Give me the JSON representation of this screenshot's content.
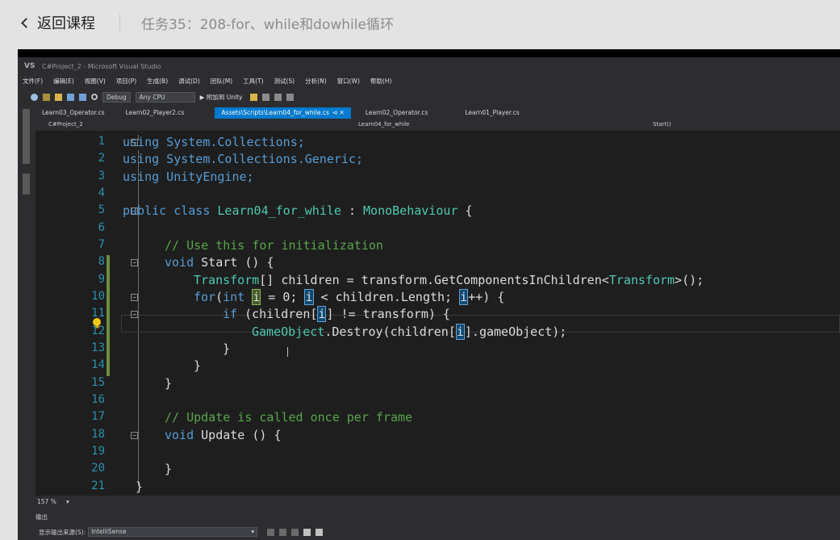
{
  "course": {
    "back_label": "返回课程",
    "task_title": "任务35：208-for、while和dowhile循环"
  },
  "vs": {
    "window_title": "C#Project_2 - Microsoft Visual Studio",
    "logo": "VS",
    "menu": [
      "文件(F)",
      "编辑(E)",
      "视图(V)",
      "项目(P)",
      "生成(B)",
      "调试(D)",
      "团队(M)",
      "工具(T)",
      "测试(S)",
      "分析(N)",
      "窗口(W)",
      "帮助(H)"
    ],
    "toolbar": {
      "config": "Debug",
      "platform": "Any CPU",
      "run": "▶ 附加到 Unity"
    },
    "tabs": [
      {
        "label": "Learn03_Operator.cs",
        "active": false
      },
      {
        "label": "Learn02_Player2.cs",
        "active": false
      },
      {
        "label": "Assets\\Scripts\\Learn04_for_while.cs",
        "active": true
      },
      {
        "label": "Learn02_Operator.cs",
        "active": false
      },
      {
        "label": "Learn01_Player.cs",
        "active": false
      }
    ],
    "active_tab_suffix": "⊲ ✕",
    "nav": {
      "project": "C#Project_2",
      "class": "Learn04_for_while",
      "member": "Start()"
    },
    "zoom": "157 %",
    "output_title": "输出",
    "output_source_label": "显示输出来源(S):",
    "output_source_value": "IntelliSense"
  },
  "code": {
    "line_numbers": [
      "1",
      "2",
      "3",
      "4",
      "5",
      "6",
      "7",
      "8",
      "9",
      "10",
      "11",
      "12",
      "13",
      "14",
      "15",
      "16",
      "17",
      "18",
      "19",
      "20",
      "21"
    ],
    "l1": "using System.Collections;",
    "l2": "using System.Collections.Generic;",
    "l3": "using UnityEngine;",
    "l5_kw": "public class ",
    "l5_ty": "Learn04_for_while",
    "l5_rest": " : ",
    "l5_base": "MonoBehaviour",
    "l5_end": " {",
    "l7": "// Use this for initialization",
    "l8_kw": "void",
    "l8_rest": " Start () {",
    "l9_ty": "Transform",
    "l9_a": "[] children = transform.GetComponentsInChildren<",
    "l9_ty2": "Transform",
    "l9_b": ">();",
    "l10_kw": "for",
    "l10_a": "(",
    "l10_kw2": "int",
    "l10_i": "i",
    "l10_b": " = 0; ",
    "l10_c": " < children.Length; ",
    "l10_d": "++) {",
    "l11_kw": "if",
    "l11_a": " (children[",
    "l11_b": "] != transform) {",
    "l12_ty": "GameObject",
    "l12_a": ".Destroy(children[",
    "l12_b": "].gameObject);",
    "l13": "}",
    "l14": "}",
    "l15": "}",
    "l17": "// Update is called once per frame",
    "l18_kw": "void",
    "l18_rest": " Update () {",
    "l20": "}",
    "l21": "}"
  }
}
